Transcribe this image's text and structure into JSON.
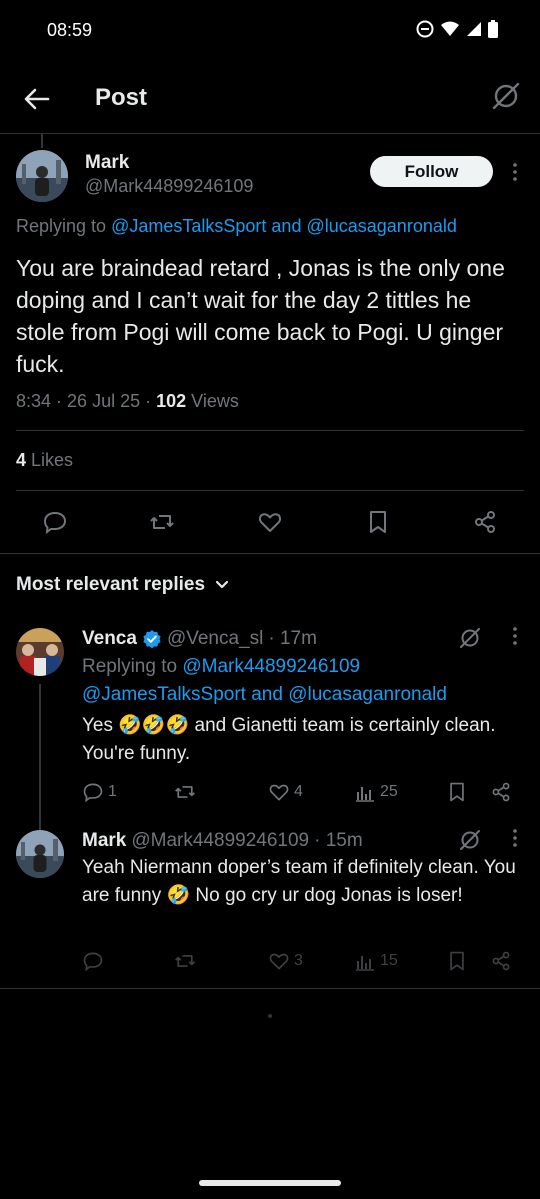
{
  "status_bar": {
    "time": "08:59"
  },
  "header": {
    "title": "Post"
  },
  "main_post": {
    "author_name": "Mark",
    "author_handle": "@Mark44899246109",
    "follow_label": "Follow",
    "replying_prefix": "Replying to",
    "replying_to_1": "@JamesTalksSport",
    "replying_and": "and",
    "replying_to_2": "@lucasaganronald",
    "text": "You are braindead retard , Jonas is the only one doping and I can’t wait for the day 2 tittles he stole from Pogi will come back to Pogi. U ginger fuck.",
    "time": "8:34",
    "date": "26 Jul 25",
    "views_count": "102",
    "views_label": "Views",
    "likes_count": "4",
    "likes_label": "Likes"
  },
  "sort": {
    "label": "Most relevant replies"
  },
  "replies": [
    {
      "name": "Venca",
      "verified": true,
      "handle": "@Venca_sl",
      "age": "· 17m",
      "replying_prefix": "Replying to",
      "replying_to_1": "@Mark44899246109",
      "replying_to_2": "@JamesTalksSport",
      "replying_and": "and",
      "replying_to_3": "@lucasaganronald",
      "text": "Yes 🤣🤣🤣 and Gianetti team is certainly clean. You're funny.",
      "replies_count": "1",
      "likes_count": "4",
      "views_count": "25"
    },
    {
      "name": "Mark",
      "handle": "@Mark44899246109",
      "age": "· 15m",
      "text": "Yeah Niermann doper’s team if definitely clean. You are funny 🤣 No go cry ur dog Jonas is loser!",
      "likes_count": "3",
      "views_count": "15"
    }
  ],
  "colors": {
    "accent": "#1d9bf0",
    "background": "#000000",
    "muted": "#71767b",
    "text": "#e7e9ea"
  }
}
